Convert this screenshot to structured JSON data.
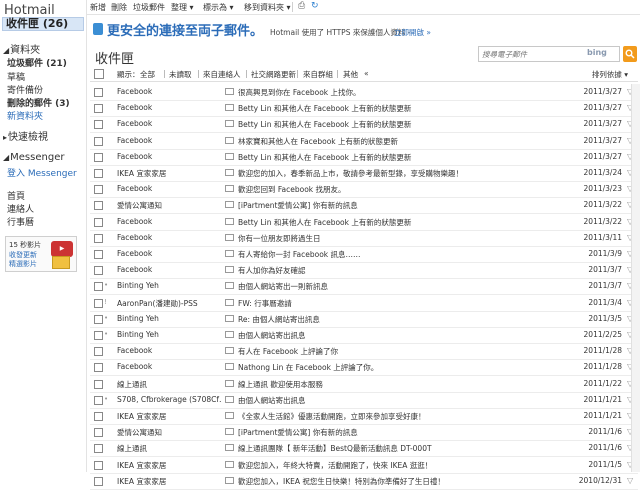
{
  "sidebar": {
    "brand": "Hotmail",
    "inbox_label": "收件匣 (26)",
    "folders_header": "資料夾",
    "folders": [
      {
        "label": "垃圾郵件 (21)",
        "bold": true
      },
      {
        "label": "草稿",
        "bold": false
      },
      {
        "label": "寄件備份",
        "bold": false
      },
      {
        "label": "刪除的郵件 (3)",
        "bold": true
      },
      {
        "label": "新資料夾",
        "bold": false,
        "link": true
      }
    ],
    "quick_views_header": "快速檢視",
    "messenger_header": "Messenger",
    "messenger_link": "登入 Messenger",
    "links": [
      "首頁",
      "連絡人",
      "行事曆"
    ],
    "promo": {
      "line1": "15 秒影片",
      "line2": "收發更新",
      "line3": "精選影片"
    }
  },
  "toolbar": {
    "items": [
      "新增",
      "刪除",
      "垃圾郵件",
      "整理 ▾",
      "標示為 ▾",
      "移到資料夾 ▾"
    ],
    "print_icon": "print-icon",
    "refresh_icon": "refresh-icon"
  },
  "banner": {
    "headline": "更安全的連接至両子郵件。",
    "text": "Hotmail 使用了 HTTPS 來保護個人資料 -",
    "link": "立即開啟 »"
  },
  "page_title": "收件匣",
  "search": {
    "placeholder": "搜尋電子郵件",
    "engine": "bing"
  },
  "filters": {
    "items": [
      "顯示：",
      "全部",
      "未讀取",
      "來自連絡人",
      "社交網路更新",
      "來自群組",
      "其他",
      "«"
    ],
    "arrange": "排列依據 ▾"
  },
  "messages": [
    {
      "sender": "Facebook",
      "subject": "很高興見到你在 Facebook 上找你。",
      "date": "2011/3/27",
      "flag": ""
    },
    {
      "sender": "Facebook",
      "subject": "Betty Lin 和其他人在 Facebook 上有新的狀態更新",
      "date": "2011/3/27",
      "flag": ""
    },
    {
      "sender": "Facebook",
      "subject": "Betty Lin 和其他人在 Facebook 上有新的狀態更新",
      "date": "2011/3/27",
      "flag": ""
    },
    {
      "sender": "Facebook",
      "subject": "林家寶和其他人在 Facebook 上有新的狀態更新",
      "date": "2011/3/27",
      "flag": ""
    },
    {
      "sender": "Facebook",
      "subject": "Betty Lin 和其他人在 Facebook 上有新的狀態更新",
      "date": "2011/3/27",
      "flag": ""
    },
    {
      "sender": "IKEA 宜家家居",
      "subject": "歡迎您的加入，春季新品上市，敬請參考最新型錄，享受購物樂趣！",
      "date": "2011/3/24",
      "flag": ""
    },
    {
      "sender": "Facebook",
      "subject": "歡迎您回到 Facebook 找朋友。",
      "date": "2011/3/23",
      "flag": ""
    },
    {
      "sender": "愛情公寓通知",
      "subject": "[iPartment愛情公寓] 你有新的訊息",
      "date": "2011/3/22",
      "flag": ""
    },
    {
      "sender": "Facebook",
      "subject": "Betty Lin 和其他人在 Facebook 上有新的狀態更新",
      "date": "2011/3/22",
      "flag": ""
    },
    {
      "sender": "Facebook",
      "subject": "你有一位朋友即將過生日",
      "date": "2011/3/11",
      "flag": ""
    },
    {
      "sender": "Facebook",
      "subject": "有人寄給你一封 Facebook 訊息……",
      "date": "2011/3/9",
      "flag": ""
    },
    {
      "sender": "Facebook",
      "subject": "有人加你為好友確認",
      "date": "2011/3/7",
      "flag": ""
    },
    {
      "sender": "Binting Yeh",
      "subject": "由個人網站寄出一則新訊息",
      "date": "2011/3/7",
      "flag": "•"
    },
    {
      "sender": "AaronPan(潘建勛)-PSS",
      "subject": "FW: 行事曆邀請",
      "date": "2011/3/4",
      "flag": "!"
    },
    {
      "sender": "Binting Yeh",
      "subject": "Re: 由個人網站寄出訊息",
      "date": "2011/3/5",
      "flag": "•"
    },
    {
      "sender": "Binting Yeh",
      "subject": "由個人網站寄出訊息",
      "date": "2011/2/25",
      "flag": "•"
    },
    {
      "sender": "Facebook",
      "subject": "有人在 Facebook 上評論了你",
      "date": "2011/1/28",
      "flag": ""
    },
    {
      "sender": "Facebook",
      "subject": "Nathong Lin 在 Facebook 上評論了你。",
      "date": "2011/1/28",
      "flag": ""
    },
    {
      "sender": "線上通訊",
      "subject": "線上通訊 歡迎使用本服務",
      "date": "2011/1/22",
      "flag": ""
    },
    {
      "sender": "S708, Cfbrokerage (S708Cf…",
      "subject": "由個人網站寄出訊息",
      "date": "2011/1/21",
      "flag": "•"
    },
    {
      "sender": "IKEA 宜家家居",
      "subject": "《全家人生活館》優惠活動開跑，立即來參加享受好康！",
      "date": "2011/1/21",
      "flag": ""
    },
    {
      "sender": "愛情公寓通知",
      "subject": "[iPartment愛情公寓] 你有新的訊息",
      "date": "2011/1/6",
      "flag": ""
    },
    {
      "sender": "線上通訊",
      "subject": "線上通訊團隊【 新年活動】BestQ最新活動訊息 DT-000T",
      "date": "2011/1/6",
      "flag": ""
    },
    {
      "sender": "IKEA 宜家家居",
      "subject": "歡迎您加入，年終大特賣，活動開跑了，快來 IKEA 逛逛！",
      "date": "2011/1/5",
      "flag": ""
    },
    {
      "sender": "IKEA 宜家家居",
      "subject": "歡迎您加入，IKEA 祝您生日快樂！特別為你準備好了生日禮！",
      "date": "2010/12/31",
      "flag": ""
    }
  ],
  "colors": {
    "accent": "#2b6cb8",
    "selected_bg": "#d8e6f6",
    "bing_button": "#f29b1c"
  }
}
